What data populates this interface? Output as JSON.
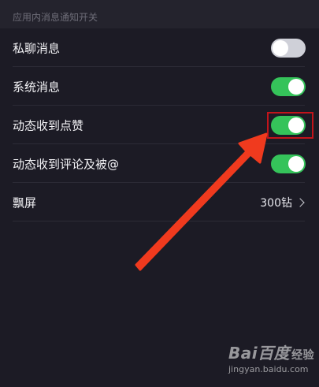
{
  "section": {
    "title": "应用内消息通知开关"
  },
  "settings": [
    {
      "label": "私聊消息",
      "control": "toggle",
      "state": "off"
    },
    {
      "label": "系统消息",
      "control": "toggle",
      "state": "on"
    },
    {
      "label": "动态收到点赞",
      "control": "toggle",
      "state": "on"
    },
    {
      "label": "动态收到评论及被@",
      "control": "toggle",
      "state": "on"
    },
    {
      "label": "飘屏",
      "control": "value",
      "value": "300钻"
    }
  ],
  "annotation": {
    "highlight_color": "#c3141b",
    "arrow_color": "#f03a1e"
  },
  "watermark": {
    "logo": "Bai百度",
    "tag": "经验",
    "url": "jingyan.baidu.com"
  },
  "colors": {
    "background": "#1c1b25",
    "toggle_on": "#35c35a",
    "toggle_off": "#cfd0d8"
  }
}
